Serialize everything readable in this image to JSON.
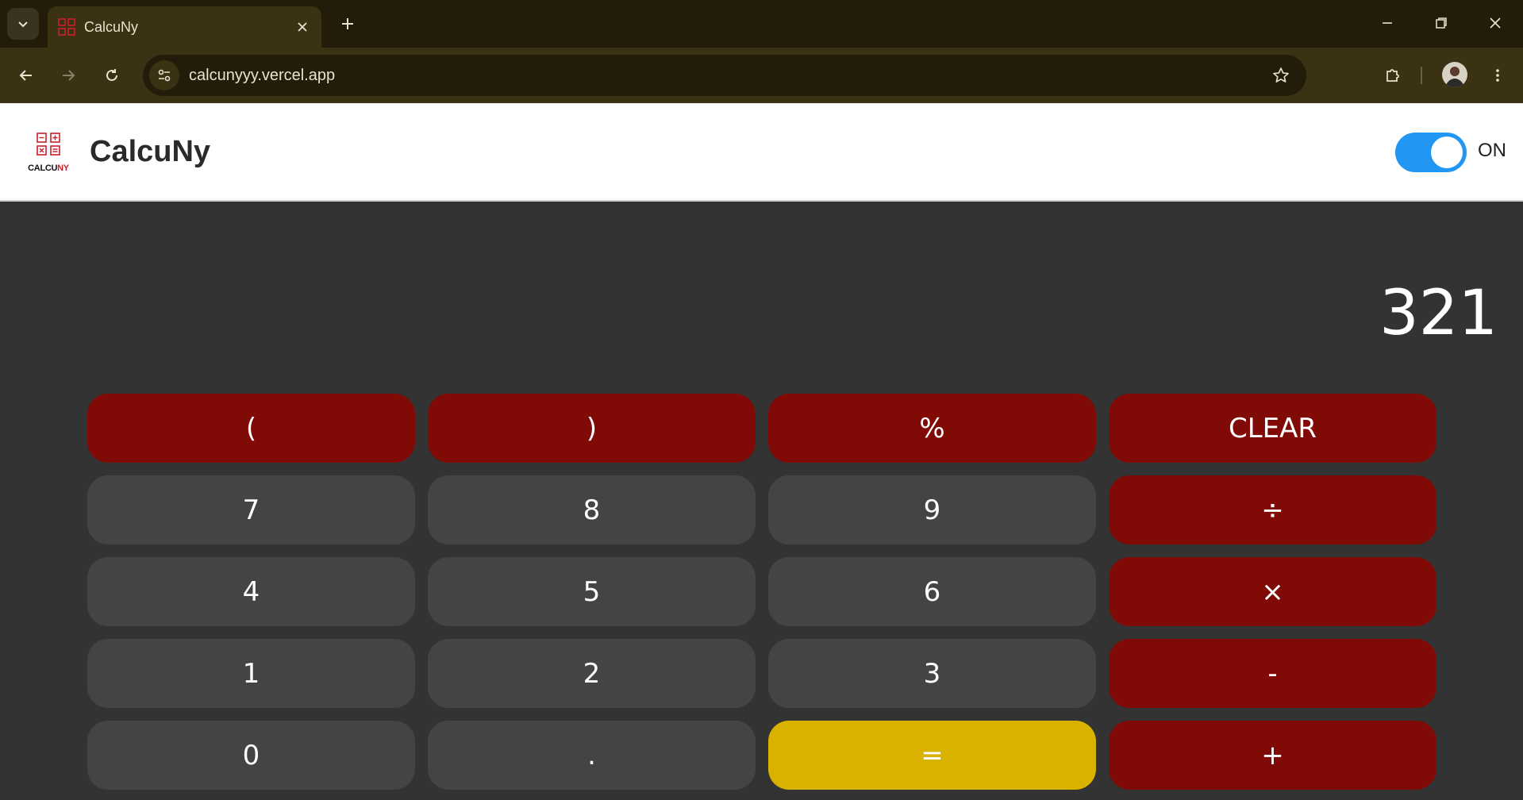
{
  "browser": {
    "tab_title": "CalcuNy",
    "url": "calcunyyy.vercel.app"
  },
  "app": {
    "logo_text_dark": "CALCU",
    "logo_text_red": "NY",
    "title": "CalcuNy",
    "toggle_label": "ON",
    "toggle_on": true,
    "toggle_color": "#2196f3"
  },
  "calculator": {
    "display": "321",
    "keys": [
      {
        "label": "(",
        "kind": "op"
      },
      {
        "label": ")",
        "kind": "op"
      },
      {
        "label": "%",
        "kind": "op"
      },
      {
        "label": "CLEAR",
        "kind": "op"
      },
      {
        "label": "7",
        "kind": "num"
      },
      {
        "label": "8",
        "kind": "num"
      },
      {
        "label": "9",
        "kind": "num"
      },
      {
        "label": "÷",
        "kind": "op"
      },
      {
        "label": "4",
        "kind": "num"
      },
      {
        "label": "5",
        "kind": "num"
      },
      {
        "label": "6",
        "kind": "num"
      },
      {
        "label": "×",
        "kind": "op"
      },
      {
        "label": "1",
        "kind": "num"
      },
      {
        "label": "2",
        "kind": "num"
      },
      {
        "label": "3",
        "kind": "num"
      },
      {
        "label": "-",
        "kind": "op"
      },
      {
        "label": "0",
        "kind": "num"
      },
      {
        "label": ".",
        "kind": "num"
      },
      {
        "label": "=",
        "kind": "eq"
      },
      {
        "label": "+",
        "kind": "op"
      }
    ],
    "colors": {
      "background": "#333333",
      "number_key": "#444444",
      "operator_key": "#800a05",
      "equals_key": "#d9b200"
    }
  }
}
